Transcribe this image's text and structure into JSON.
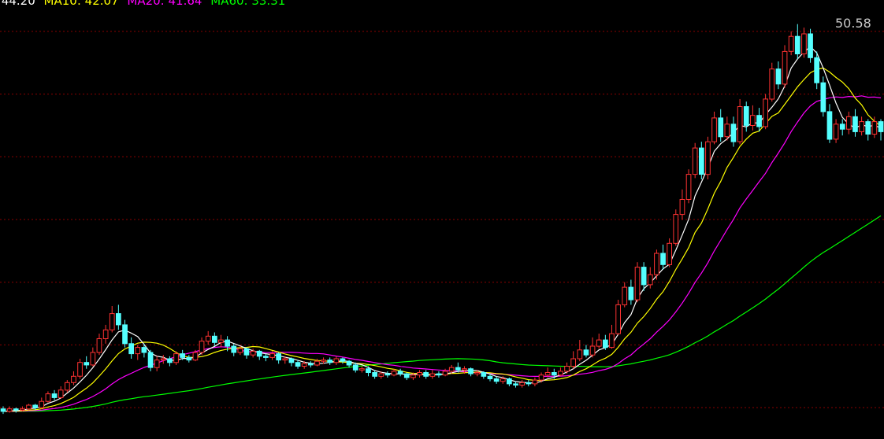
{
  "legend": {
    "ma5": ": 44.20",
    "ma10": "MA10: 42.07",
    "ma20": "MA20: 41.64",
    "ma60": "MA60: 33.31"
  },
  "chart_data": {
    "type": "candlestick",
    "y_range": [
      17.5,
      52.5
    ],
    "peak_label": "50.58",
    "gridlines": [
      50,
      45,
      40,
      35,
      30,
      25,
      20
    ],
    "colors": {
      "up": "#ff3232",
      "down": "#54ffff",
      "ma5": "#ffffff",
      "ma10": "#ffff00",
      "ma20": "#ff00ff",
      "ma60": "#00ff00",
      "grid": "#8b0000"
    },
    "candles": [
      {
        "o": 19.9,
        "c": 19.7,
        "h": 20.1,
        "l": 19.5
      },
      {
        "o": 19.7,
        "c": 19.9,
        "h": 20.1,
        "l": 19.6
      },
      {
        "o": 19.9,
        "c": 19.8,
        "h": 20.0,
        "l": 19.6
      },
      {
        "o": 19.8,
        "c": 19.9,
        "h": 20.1,
        "l": 19.7
      },
      {
        "o": 19.9,
        "c": 20.2,
        "h": 20.3,
        "l": 19.8
      },
      {
        "o": 20.2,
        "c": 20.0,
        "h": 20.3,
        "l": 19.8
      },
      {
        "o": 20.0,
        "c": 20.5,
        "h": 20.8,
        "l": 19.9
      },
      {
        "o": 20.5,
        "c": 21.1,
        "h": 21.3,
        "l": 20.4
      },
      {
        "o": 21.1,
        "c": 20.8,
        "h": 21.4,
        "l": 20.6
      },
      {
        "o": 20.8,
        "c": 21.4,
        "h": 21.7,
        "l": 20.7
      },
      {
        "o": 21.4,
        "c": 22.0,
        "h": 22.2,
        "l": 21.2
      },
      {
        "o": 22.0,
        "c": 22.5,
        "h": 22.9,
        "l": 21.8
      },
      {
        "o": 22.5,
        "c": 23.6,
        "h": 23.9,
        "l": 22.3
      },
      {
        "o": 23.6,
        "c": 23.4,
        "h": 24.1,
        "l": 23.1
      },
      {
        "o": 23.4,
        "c": 24.4,
        "h": 24.8,
        "l": 23.3
      },
      {
        "o": 24.4,
        "c": 25.5,
        "h": 25.9,
        "l": 24.2
      },
      {
        "o": 25.5,
        "c": 26.2,
        "h": 26.6,
        "l": 25.1
      },
      {
        "o": 26.2,
        "c": 27.5,
        "h": 28.1,
        "l": 26.0
      },
      {
        "o": 27.5,
        "c": 26.6,
        "h": 28.2,
        "l": 26.2
      },
      {
        "o": 26.6,
        "c": 25.1,
        "h": 27.0,
        "l": 24.8
      },
      {
        "o": 25.1,
        "c": 24.3,
        "h": 25.6,
        "l": 23.9
      },
      {
        "o": 24.3,
        "c": 24.8,
        "h": 25.0,
        "l": 23.8
      },
      {
        "o": 24.8,
        "c": 24.4,
        "h": 25.1,
        "l": 24.0
      },
      {
        "o": 24.4,
        "c": 23.2,
        "h": 24.6,
        "l": 22.9
      },
      {
        "o": 23.2,
        "c": 23.8,
        "h": 24.1,
        "l": 22.9
      },
      {
        "o": 23.8,
        "c": 23.9,
        "h": 24.2,
        "l": 23.5
      },
      {
        "o": 23.9,
        "c": 23.6,
        "h": 24.1,
        "l": 23.3
      },
      {
        "o": 23.6,
        "c": 24.3,
        "h": 24.5,
        "l": 23.4
      },
      {
        "o": 24.3,
        "c": 24.0,
        "h": 24.6,
        "l": 23.8
      },
      {
        "o": 24.0,
        "c": 23.8,
        "h": 24.2,
        "l": 23.6
      },
      {
        "o": 23.8,
        "c": 24.4,
        "h": 24.6,
        "l": 23.7
      },
      {
        "o": 24.4,
        "c": 25.3,
        "h": 25.6,
        "l": 24.2
      },
      {
        "o": 25.3,
        "c": 25.7,
        "h": 26.1,
        "l": 25.0
      },
      {
        "o": 25.7,
        "c": 25.2,
        "h": 26.0,
        "l": 24.9
      },
      {
        "o": 25.2,
        "c": 25.4,
        "h": 25.8,
        "l": 24.8
      },
      {
        "o": 25.4,
        "c": 24.9,
        "h": 25.7,
        "l": 24.5
      },
      {
        "o": 24.9,
        "c": 24.4,
        "h": 25.1,
        "l": 24.1
      },
      {
        "o": 24.4,
        "c": 24.7,
        "h": 24.9,
        "l": 24.2
      },
      {
        "o": 24.7,
        "c": 24.2,
        "h": 24.8,
        "l": 23.9
      },
      {
        "o": 24.2,
        "c": 24.5,
        "h": 24.7,
        "l": 24.0
      },
      {
        "o": 24.5,
        "c": 24.1,
        "h": 24.6,
        "l": 23.8
      },
      {
        "o": 24.1,
        "c": 24.0,
        "h": 24.3,
        "l": 23.7
      },
      {
        "o": 24.0,
        "c": 24.3,
        "h": 24.5,
        "l": 23.8
      },
      {
        "o": 24.3,
        "c": 23.8,
        "h": 24.4,
        "l": 23.5
      },
      {
        "o": 23.8,
        "c": 23.9,
        "h": 24.1,
        "l": 23.5
      },
      {
        "o": 23.9,
        "c": 23.6,
        "h": 24.0,
        "l": 23.3
      },
      {
        "o": 23.6,
        "c": 23.3,
        "h": 23.8,
        "l": 23.1
      },
      {
        "o": 23.3,
        "c": 23.5,
        "h": 23.7,
        "l": 23.1
      },
      {
        "o": 23.5,
        "c": 23.4,
        "h": 23.7,
        "l": 23.2
      },
      {
        "o": 23.4,
        "c": 23.7,
        "h": 23.9,
        "l": 23.3
      },
      {
        "o": 23.7,
        "c": 23.8,
        "h": 24.0,
        "l": 23.5
      },
      {
        "o": 23.8,
        "c": 23.6,
        "h": 24.0,
        "l": 23.4
      },
      {
        "o": 23.6,
        "c": 23.9,
        "h": 24.1,
        "l": 23.4
      },
      {
        "o": 23.9,
        "c": 23.7,
        "h": 24.0,
        "l": 23.5
      },
      {
        "o": 23.7,
        "c": 23.4,
        "h": 23.8,
        "l": 23.2
      },
      {
        "o": 23.4,
        "c": 23.0,
        "h": 23.6,
        "l": 22.8
      },
      {
        "o": 23.0,
        "c": 23.1,
        "h": 23.3,
        "l": 22.8
      },
      {
        "o": 23.1,
        "c": 22.8,
        "h": 23.3,
        "l": 22.5
      },
      {
        "o": 22.8,
        "c": 22.5,
        "h": 23.0,
        "l": 22.3
      },
      {
        "o": 22.5,
        "c": 22.7,
        "h": 22.9,
        "l": 22.3
      },
      {
        "o": 22.7,
        "c": 22.6,
        "h": 22.9,
        "l": 22.4
      },
      {
        "o": 22.6,
        "c": 22.9,
        "h": 23.1,
        "l": 22.5
      },
      {
        "o": 22.9,
        "c": 22.7,
        "h": 23.1,
        "l": 22.5
      },
      {
        "o": 22.7,
        "c": 22.4,
        "h": 22.8,
        "l": 22.2
      },
      {
        "o": 22.4,
        "c": 22.6,
        "h": 22.8,
        "l": 22.2
      },
      {
        "o": 22.6,
        "c": 22.8,
        "h": 23.0,
        "l": 22.4
      },
      {
        "o": 22.8,
        "c": 22.5,
        "h": 23.0,
        "l": 22.3
      },
      {
        "o": 22.5,
        "c": 22.7,
        "h": 23.0,
        "l": 22.3
      },
      {
        "o": 22.7,
        "c": 22.6,
        "h": 22.9,
        "l": 22.4
      },
      {
        "o": 22.6,
        "c": 22.9,
        "h": 23.1,
        "l": 22.5
      },
      {
        "o": 22.9,
        "c": 23.2,
        "h": 23.4,
        "l": 22.7
      },
      {
        "o": 23.2,
        "c": 23.0,
        "h": 23.6,
        "l": 22.8
      },
      {
        "o": 23.0,
        "c": 23.1,
        "h": 23.3,
        "l": 22.7
      },
      {
        "o": 23.1,
        "c": 22.7,
        "h": 23.2,
        "l": 22.5
      },
      {
        "o": 22.7,
        "c": 22.8,
        "h": 23.0,
        "l": 22.5
      },
      {
        "o": 22.8,
        "c": 22.5,
        "h": 22.9,
        "l": 22.3
      },
      {
        "o": 22.5,
        "c": 22.3,
        "h": 22.7,
        "l": 22.1
      },
      {
        "o": 22.3,
        "c": 22.1,
        "h": 22.5,
        "l": 21.9
      },
      {
        "o": 22.1,
        "c": 22.3,
        "h": 22.5,
        "l": 21.9
      },
      {
        "o": 22.3,
        "c": 21.9,
        "h": 22.4,
        "l": 21.7
      },
      {
        "o": 21.9,
        "c": 21.8,
        "h": 22.1,
        "l": 21.6
      },
      {
        "o": 21.8,
        "c": 22.0,
        "h": 22.2,
        "l": 21.6
      },
      {
        "o": 22.0,
        "c": 21.9,
        "h": 22.2,
        "l": 21.7
      },
      {
        "o": 21.9,
        "c": 22.2,
        "h": 22.4,
        "l": 21.7
      },
      {
        "o": 22.2,
        "c": 22.6,
        "h": 22.8,
        "l": 22.0
      },
      {
        "o": 22.6,
        "c": 22.8,
        "h": 23.2,
        "l": 22.4
      },
      {
        "o": 22.8,
        "c": 22.6,
        "h": 23.1,
        "l": 22.3
      },
      {
        "o": 22.6,
        "c": 22.9,
        "h": 23.2,
        "l": 22.5
      },
      {
        "o": 22.9,
        "c": 23.3,
        "h": 23.6,
        "l": 22.7
      },
      {
        "o": 23.3,
        "c": 23.9,
        "h": 24.5,
        "l": 23.1
      },
      {
        "o": 23.9,
        "c": 24.6,
        "h": 25.4,
        "l": 23.7
      },
      {
        "o": 24.6,
        "c": 24.2,
        "h": 25.0,
        "l": 24.0
      },
      {
        "o": 24.2,
        "c": 24.9,
        "h": 25.6,
        "l": 24.0
      },
      {
        "o": 24.9,
        "c": 25.4,
        "h": 25.9,
        "l": 24.7
      },
      {
        "o": 25.4,
        "c": 24.8,
        "h": 25.8,
        "l": 24.6
      },
      {
        "o": 24.8,
        "c": 25.9,
        "h": 26.6,
        "l": 24.7
      },
      {
        "o": 25.9,
        "c": 28.2,
        "h": 28.6,
        "l": 25.8
      },
      {
        "o": 28.2,
        "c": 29.6,
        "h": 30.0,
        "l": 28.0
      },
      {
        "o": 29.6,
        "c": 28.6,
        "h": 30.2,
        "l": 28.2
      },
      {
        "o": 28.6,
        "c": 31.2,
        "h": 31.6,
        "l": 28.4
      },
      {
        "o": 31.2,
        "c": 29.8,
        "h": 31.6,
        "l": 29.3
      },
      {
        "o": 29.8,
        "c": 30.6,
        "h": 31.2,
        "l": 29.5
      },
      {
        "o": 30.6,
        "c": 32.3,
        "h": 32.6,
        "l": 30.2
      },
      {
        "o": 32.3,
        "c": 31.4,
        "h": 33.0,
        "l": 31.0
      },
      {
        "o": 31.4,
        "c": 33.1,
        "h": 33.5,
        "l": 31.2
      },
      {
        "o": 33.1,
        "c": 35.4,
        "h": 35.8,
        "l": 32.9
      },
      {
        "o": 35.4,
        "c": 36.6,
        "h": 37.4,
        "l": 35.0
      },
      {
        "o": 36.6,
        "c": 38.6,
        "h": 39.0,
        "l": 36.3
      },
      {
        "o": 38.6,
        "c": 40.7,
        "h": 41.1,
        "l": 38.3
      },
      {
        "o": 40.7,
        "c": 38.6,
        "h": 41.2,
        "l": 38.2
      },
      {
        "o": 38.6,
        "c": 41.2,
        "h": 41.6,
        "l": 38.2
      },
      {
        "o": 41.2,
        "c": 43.1,
        "h": 43.6,
        "l": 41.0
      },
      {
        "o": 43.1,
        "c": 41.6,
        "h": 43.8,
        "l": 41.2
      },
      {
        "o": 41.6,
        "c": 42.6,
        "h": 43.2,
        "l": 41.3
      },
      {
        "o": 42.6,
        "c": 41.2,
        "h": 43.2,
        "l": 40.8
      },
      {
        "o": 41.2,
        "c": 44.0,
        "h": 44.6,
        "l": 41.0
      },
      {
        "o": 44.0,
        "c": 42.5,
        "h": 44.4,
        "l": 42.0
      },
      {
        "o": 42.5,
        "c": 43.3,
        "h": 44.1,
        "l": 42.1
      },
      {
        "o": 43.3,
        "c": 42.4,
        "h": 43.9,
        "l": 42.0
      },
      {
        "o": 42.4,
        "c": 44.6,
        "h": 45.0,
        "l": 42.2
      },
      {
        "o": 44.6,
        "c": 47.0,
        "h": 47.5,
        "l": 44.4
      },
      {
        "o": 47.0,
        "c": 45.8,
        "h": 47.6,
        "l": 45.4
      },
      {
        "o": 45.8,
        "c": 48.4,
        "h": 48.9,
        "l": 45.5
      },
      {
        "o": 48.4,
        "c": 49.6,
        "h": 50.0,
        "l": 48.1
      },
      {
        "o": 49.6,
        "c": 48.2,
        "h": 50.58,
        "l": 47.8
      },
      {
        "o": 48.2,
        "c": 49.8,
        "h": 50.3,
        "l": 47.9
      },
      {
        "o": 49.8,
        "c": 47.9,
        "h": 50.2,
        "l": 47.5
      },
      {
        "o": 47.9,
        "c": 45.9,
        "h": 48.4,
        "l": 45.4
      },
      {
        "o": 45.9,
        "c": 43.6,
        "h": 46.4,
        "l": 43.2
      },
      {
        "o": 43.6,
        "c": 41.4,
        "h": 44.2,
        "l": 41.1
      },
      {
        "o": 41.4,
        "c": 42.6,
        "h": 43.0,
        "l": 41.1
      },
      {
        "o": 42.6,
        "c": 42.2,
        "h": 43.0,
        "l": 41.7
      },
      {
        "o": 42.2,
        "c": 43.2,
        "h": 43.6,
        "l": 41.8
      },
      {
        "o": 43.2,
        "c": 42.0,
        "h": 43.8,
        "l": 41.6
      },
      {
        "o": 42.0,
        "c": 42.8,
        "h": 43.2,
        "l": 41.7
      },
      {
        "o": 42.8,
        "c": 41.8,
        "h": 43.0,
        "l": 41.3
      },
      {
        "o": 41.8,
        "c": 42.8,
        "h": 43.2,
        "l": 41.5
      },
      {
        "o": 42.8,
        "c": 42.0,
        "h": 43.0,
        "l": 41.3
      }
    ]
  }
}
